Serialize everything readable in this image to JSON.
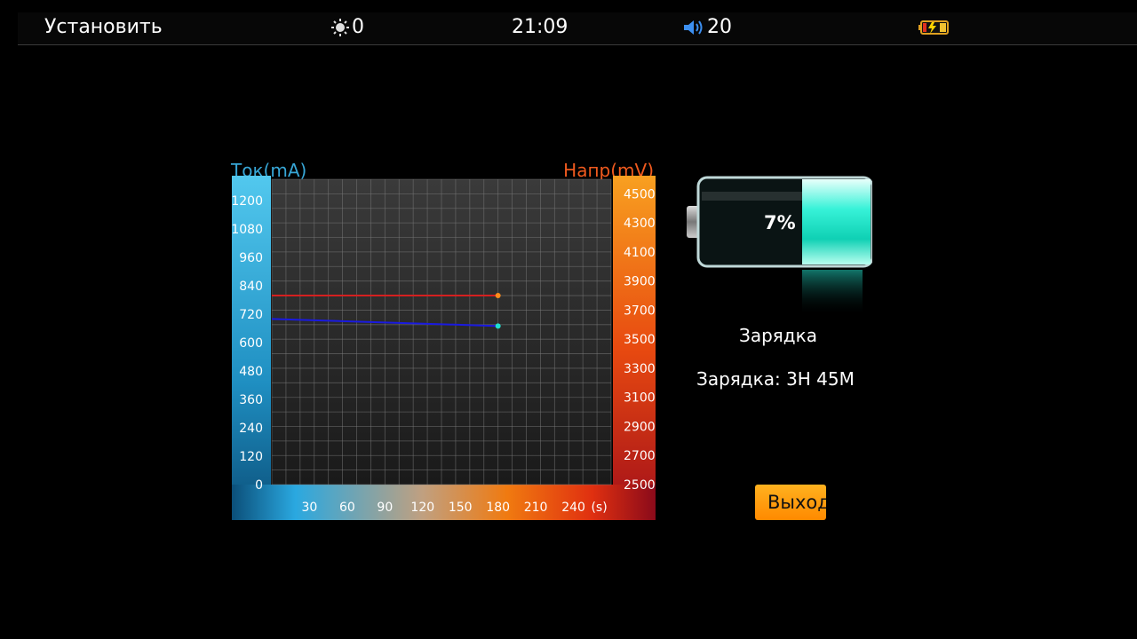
{
  "statusbar": {
    "title": "Установить",
    "brightness": "0",
    "clock": "21:09",
    "volume": "20"
  },
  "chart_data": {
    "type": "line",
    "left_axis_title": "Ток(mA)",
    "right_axis_title": "Напр(mV)",
    "x_unit": "(s)",
    "x_ticks": [
      30,
      60,
      90,
      120,
      150,
      180,
      210,
      240
    ],
    "left_ticks": [
      0,
      120,
      240,
      360,
      480,
      600,
      720,
      840,
      960,
      1080,
      1200
    ],
    "right_ticks": [
      2500,
      2700,
      2900,
      3100,
      3300,
      3500,
      3700,
      3900,
      4100,
      4300,
      4500
    ],
    "xlim": [
      0,
      270
    ],
    "ylim_left": [
      0,
      1290
    ],
    "ylim_right": [
      2500,
      4600
    ],
    "series": [
      {
        "color": "#d42020",
        "axis": "right",
        "x": [
          0,
          180
        ],
        "y": [
          3800,
          3800
        ],
        "end_marker_color": "#ff8c1a"
      },
      {
        "color": "#1a1ae0",
        "axis": "left",
        "x": [
          0,
          180
        ],
        "y": [
          700,
          670
        ],
        "end_marker_color": "#20e0d0"
      }
    ],
    "grid": true
  },
  "battery": {
    "percent_label": "7%",
    "status_label": "Зарядка",
    "time_label": "Зарядка: 3H 45M"
  },
  "buttons": {
    "exit_label": "Выход"
  },
  "colors": {
    "current_axis": "#37a6d6",
    "voltage_axis": "#f05a1e",
    "battery_fill": "#1fe3c8",
    "exit_button": "#ff9a10"
  }
}
